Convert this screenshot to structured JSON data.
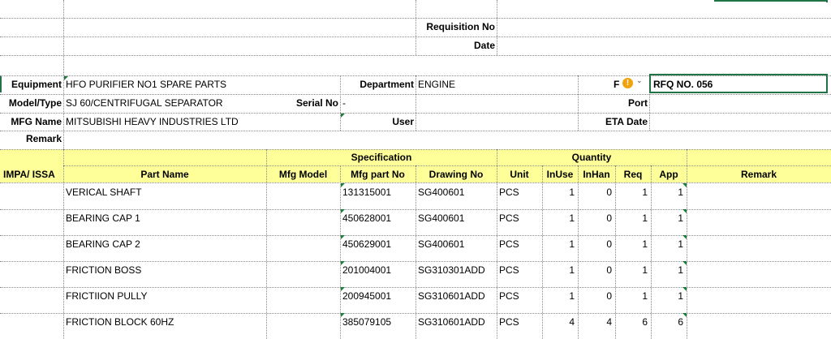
{
  "top": {
    "requisition_label": "Requisition No",
    "date_label": "Date"
  },
  "form": {
    "equipment_label": "Equipment",
    "equipment_value": "HFO PURIFIER NO1 SPARE PARTS",
    "department_label": "Department",
    "department_value": "ENGINE",
    "partial_label": "F",
    "rfq_value": "RFQ NO. 056",
    "model_label": "Model/Type",
    "model_value": "SJ 60/CENTRIFUGAL SEPARATOR",
    "serial_label": "Serial No",
    "serial_value": "-",
    "port_label": "Port",
    "mfg_name_label": "MFG Name",
    "mfg_name_value": "MITSUBISHI HEAVY INDUSTRIES LTD",
    "user_label": "User",
    "eta_label": "ETA Date",
    "remark_label": "Remark"
  },
  "table": {
    "group_spec": "Specification",
    "group_qty": "Quantity",
    "headers": {
      "impa": "IMPA/ ISSA",
      "part_name": "Part Name",
      "mfg_model": "Mfg Model",
      "mfg_part_no": "Mfg part No",
      "drawing_no": "Drawing No",
      "unit": "Unit",
      "inuse": "InUse",
      "inhand": "InHan",
      "req": "Req",
      "app": "App",
      "remark": "Remark"
    },
    "rows": [
      {
        "impa": "",
        "part_name": "VERICAL SHAFT",
        "mfg_model": "",
        "mfg_part_no": "131315001",
        "drawing_no": "SG400601",
        "unit": "PCS",
        "inuse": "1",
        "inhand": "0",
        "req": "1",
        "app": "1",
        "remark": ""
      },
      {
        "impa": "",
        "part_name": "BEARING CAP 1",
        "mfg_model": "",
        "mfg_part_no": "450628001",
        "drawing_no": "SG400601",
        "unit": "PCS",
        "inuse": "1",
        "inhand": "0",
        "req": "1",
        "app": "1",
        "remark": ""
      },
      {
        "impa": "",
        "part_name": "BEARING CAP 2",
        "mfg_model": "",
        "mfg_part_no": "450629001",
        "drawing_no": "SG400601",
        "unit": "PCS",
        "inuse": "1",
        "inhand": "0",
        "req": "1",
        "app": "1",
        "remark": ""
      },
      {
        "impa": "",
        "part_name": "FRICTION BOSS",
        "mfg_model": "",
        "mfg_part_no": "201004001",
        "drawing_no": "SG310301ADD",
        "unit": "PCS",
        "inuse": "1",
        "inhand": "0",
        "req": "1",
        "app": "1",
        "remark": ""
      },
      {
        "impa": "",
        "part_name": "FRICTIION PULLY",
        "mfg_model": "",
        "mfg_part_no": "200945001",
        "drawing_no": "SG310601ADD",
        "unit": "PCS",
        "inuse": "1",
        "inhand": "0",
        "req": "1",
        "app": "1",
        "remark": ""
      },
      {
        "impa": "",
        "part_name": "FRICTION BLOCK 60HZ",
        "mfg_model": "",
        "mfg_part_no": "385079105",
        "drawing_no": "SG310601ADD",
        "unit": "PCS",
        "inuse": "4",
        "inhand": "4",
        "req": "6",
        "app": "6",
        "remark": ""
      }
    ]
  },
  "icons": {
    "warning": "warning-icon",
    "dropdown": "chevron-down-icon"
  },
  "colors": {
    "header_fill": "#ffff99",
    "selection": "#217346",
    "indicator": "#1e7b34",
    "warning": "#f0a30a"
  }
}
